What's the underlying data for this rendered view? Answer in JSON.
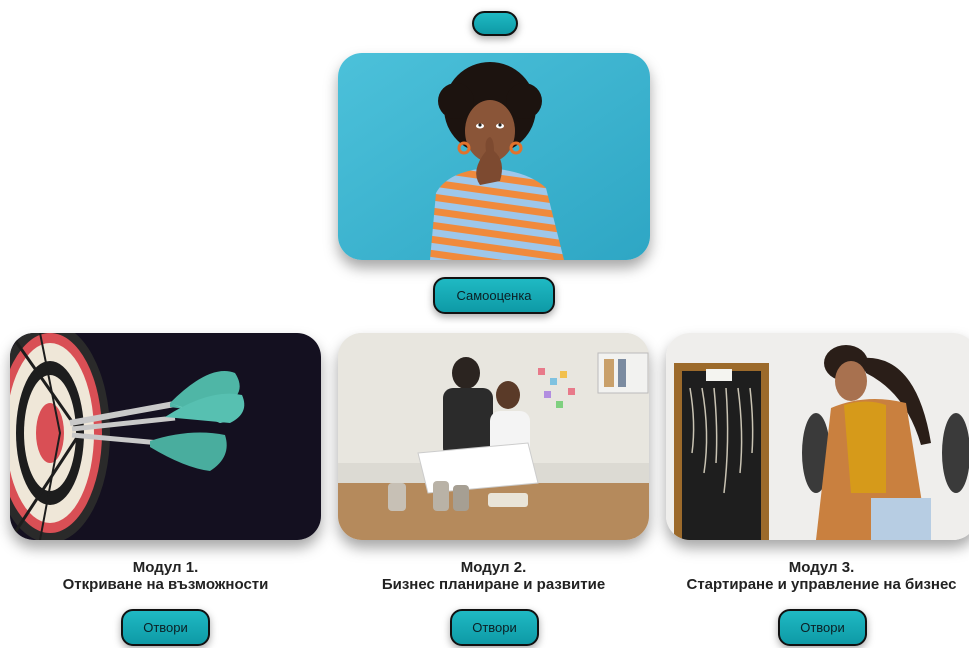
{
  "top_button": {
    "label": ""
  },
  "hero": {
    "image_icon": "woman-thinking-image",
    "button_label": "Самооценка"
  },
  "modules": [
    {
      "title_line1": "Модул 1.",
      "title_line2": "Откриване на възможности",
      "button_label": "Отвори",
      "image_icon": "darts-target-image"
    },
    {
      "title_line1": "Модул 2.",
      "title_line2": "Бизнес планиране и развитие",
      "button_label": "Отвори",
      "image_icon": "planning-meeting-image"
    },
    {
      "title_line1": "Модул 3.",
      "title_line2": "Стартиране и управление на бизнес",
      "button_label": "Отвори",
      "image_icon": "jewelry-shop-image"
    }
  ],
  "colors": {
    "accent": "#1fb9c3",
    "hero_bg": "#3fb3d1"
  }
}
